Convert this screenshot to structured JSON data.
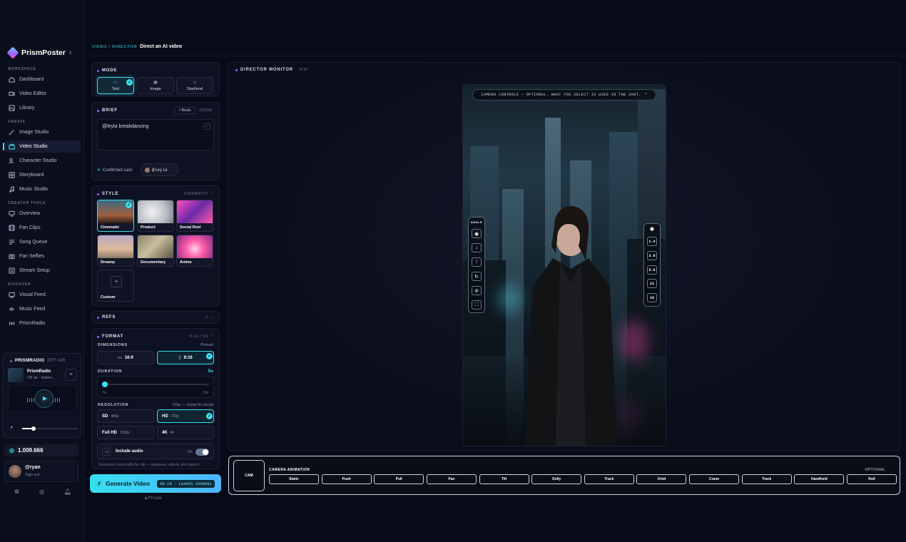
{
  "app": {
    "name": "PrismPoster"
  },
  "sidebar": {
    "sections": [
      {
        "title": "WORKSPACE",
        "items": [
          "Dashboard",
          "Video Editor",
          "Library"
        ]
      },
      {
        "title": "CREATE",
        "items": [
          "Image Studio",
          "Video Studio",
          "Character Studio",
          "Storyboard",
          "Music Studio"
        ]
      },
      {
        "title": "CREATOR TOOLS",
        "items": [
          "Overview",
          "Fan Clips",
          "Song Queue",
          "Fan Selfies",
          "Stream Setup"
        ]
      },
      {
        "title": "DISCOVER",
        "items": [
          "Visual Feed",
          "Music Feed",
          "PrismRadio"
        ]
      }
    ],
    "active": "Video Studio",
    "radio": {
      "title": "PRISMRADIO",
      "status": "OFF AIR",
      "station": "PrismRadio",
      "subtitle": "Off air · betwe...",
      "volume": 0.21
    },
    "credits": "1.009.666",
    "user": {
      "name": "@ryan",
      "action": "Sign out"
    }
  },
  "breadcrumb": {
    "path": "VIDEO / DIRECTOR",
    "title": "Direct an AI video"
  },
  "mode": {
    "title": "MODE",
    "options": [
      "Text",
      "Image",
      "Start/end"
    ],
    "selected": "Text"
  },
  "brief": {
    "title": "BRIEF",
    "beats_label": "+ Beats",
    "count": "13/2000",
    "text": "@leyla breakdancing",
    "cast_label": "Confirmed cast:",
    "cast": "@leyla"
  },
  "style": {
    "title": "STYLE",
    "current": "CINEMATIC",
    "options": [
      "Cinematic",
      "Product",
      "Social Reel",
      "Dreamy",
      "Documentary",
      "Anime",
      "Custom"
    ],
    "selected": "Cinematic"
  },
  "refs": {
    "title": "REFS",
    "count": "1"
  },
  "format": {
    "title": "FORMAT",
    "summary": "9:16 / 5S",
    "dimensions_label": "DIMENSIONS",
    "dimensions_hint": "Portrait",
    "dimensions": [
      "16:9",
      "9:16"
    ],
    "dimension_selected": "9:16",
    "duration_label": "DURATION",
    "duration_value": "5s",
    "duration_min": "5s",
    "duration_max": "15s",
    "resolution_label": "RESOLUTION",
    "resolution_hint": "720p — sharp for social",
    "resolutions": [
      {
        "name": "SD",
        "sub": "480p"
      },
      {
        "name": "HD",
        "sub": "720p"
      },
      {
        "name": "Full HD",
        "sub": "1080p"
      },
      {
        "name": "4K",
        "sub": "4k"
      }
    ],
    "resolution_selected": "HD",
    "audio_label": "Include audio",
    "audio_state": "On",
    "audio_hint": "Generates sound with the clip — ambience, effects, and speech."
  },
  "generate": {
    "label": "Generate Video",
    "cost": "85 CR · LEAVES 1009581",
    "privacy": "Private"
  },
  "monitor": {
    "title": "DIRECTOR MONITOR",
    "ratio": "9:16",
    "camera_controls": "CAMERA CONTROLS — OPTIONAL. WHAT YOU SELECT IS USED IN THE SHOT.",
    "angle_label": "ANGLE",
    "fstops": [
      "1.4",
      "2.8",
      "5.6",
      "11",
      "16"
    ]
  },
  "camera_animation": {
    "cam_label": "CAM",
    "title": "CAMERA ANIMATION",
    "optional": "OPTIONAL",
    "moves": [
      "Static",
      "Push",
      "Pull",
      "Pan",
      "Tilt",
      "Dolly",
      "Track",
      "Orbit",
      "Crane",
      "Track",
      "Handheld",
      "Roll"
    ]
  }
}
